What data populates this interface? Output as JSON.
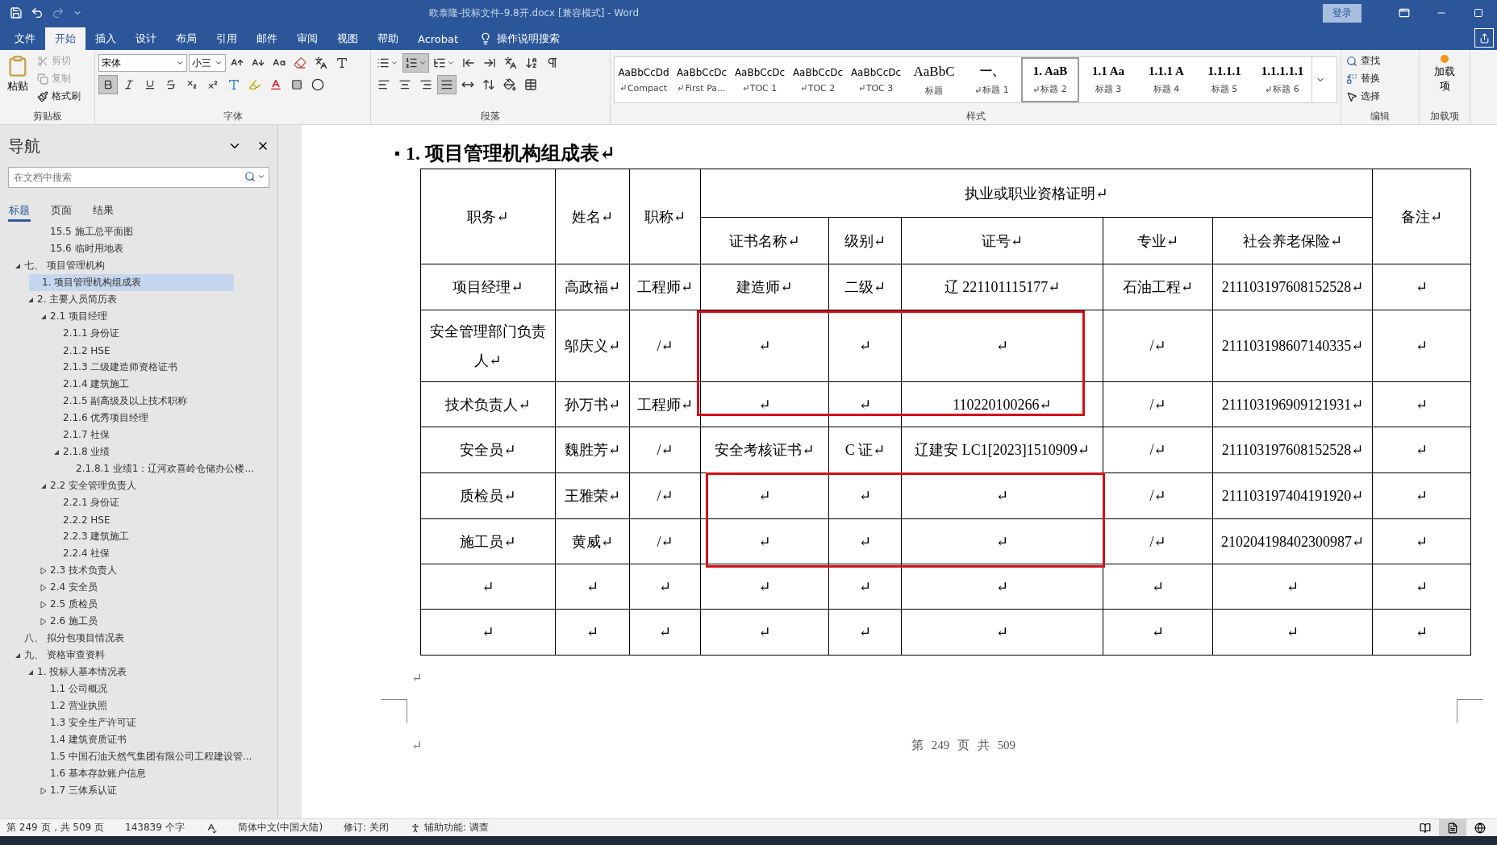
{
  "window": {
    "title": "欧泰隆-投标文件-9.8开.docx [兼容模式]  -  Word",
    "sign_in": "登录"
  },
  "ribbon_tabs": [
    {
      "label": "文件",
      "selected": false
    },
    {
      "label": "开始",
      "selected": true
    },
    {
      "label": "插入",
      "selected": false
    },
    {
      "label": "设计",
      "selected": false
    },
    {
      "label": "布局",
      "selected": false
    },
    {
      "label": "引用",
      "selected": false
    },
    {
      "label": "邮件",
      "selected": false
    },
    {
      "label": "审阅",
      "selected": false
    },
    {
      "label": "视图",
      "selected": false
    },
    {
      "label": "帮助",
      "selected": false
    },
    {
      "label": "Acrobat",
      "selected": false
    }
  ],
  "tell_me": "操作说明搜索",
  "clipboard": {
    "label": "剪贴板",
    "paste": "粘贴",
    "cut": {
      "label": "剪切",
      "disabled": true
    },
    "copy": {
      "label": "复制",
      "disabled": true
    },
    "format_painter": {
      "label": "格式刷",
      "disabled": false
    }
  },
  "font": {
    "label": "字体",
    "name": "宋体",
    "size": "小三",
    "format_buttons": [
      {
        "active": true
      },
      {
        "active": false
      },
      {
        "active": false
      },
      {
        "active": false
      },
      {
        "active": false
      },
      {
        "active": false
      }
    ]
  },
  "paragraph": {
    "label": "段落",
    "list_buttons": [
      {
        "active": false
      },
      {
        "active": true
      },
      {
        "active": false
      }
    ],
    "align_buttons": [
      {
        "active": false
      },
      {
        "active": false
      },
      {
        "active": false
      },
      {
        "active": true
      },
      {
        "active": false
      }
    ]
  },
  "styles": {
    "label": "样式",
    "items": [
      {
        "preview": "AaBbCcDd",
        "name": "Compact",
        "kind": "body",
        "paragraph_mark": true,
        "selected": false
      },
      {
        "preview": "AaBbCcDc",
        "name": "First Pa...",
        "kind": "body",
        "paragraph_mark": true,
        "selected": false
      },
      {
        "preview": "AaBbCcDc",
        "name": "TOC 1",
        "kind": "body",
        "paragraph_mark": true,
        "selected": false
      },
      {
        "preview": "AaBbCcDc",
        "name": "TOC 2",
        "kind": "body",
        "paragraph_mark": true,
        "selected": false
      },
      {
        "preview": "AaBbCcDc",
        "name": "TOC 3",
        "kind": "body",
        "paragraph_mark": true,
        "selected": false
      },
      {
        "preview": "AaBbC",
        "name": "标题",
        "kind": "title",
        "paragraph_mark": false,
        "selected": false
      },
      {
        "preview": "一、",
        "name": "标题 1",
        "kind": "heading",
        "paragraph_mark": true,
        "selected": false
      },
      {
        "preview": "1. AaB",
        "name": "标题 2",
        "kind": "heading",
        "paragraph_mark": true,
        "selected": true
      },
      {
        "preview": "1.1 Aa",
        "name": "标题 3",
        "kind": "heading",
        "paragraph_mark": false,
        "selected": false
      },
      {
        "preview": "1.1.1 A",
        "name": "标题 4",
        "kind": "heading",
        "paragraph_mark": false,
        "selected": false
      },
      {
        "preview": "1.1.1.1",
        "name": "标题 5",
        "kind": "heading",
        "paragraph_mark": false,
        "selected": false
      },
      {
        "preview": "1.1.1.1.1",
        "name": "标题 6",
        "kind": "heading",
        "paragraph_mark": true,
        "selected": false
      }
    ]
  },
  "editing": {
    "label": "编辑",
    "find": "查找",
    "replace": "替换",
    "select": "选择"
  },
  "addins": {
    "label": "加载项",
    "button": "加载项"
  },
  "navigation": {
    "title": "导航",
    "search": {
      "placeholder": "在文档中搜索"
    },
    "tabs": [
      {
        "label": "标题",
        "selected": true
      },
      {
        "label": "页面",
        "selected": false
      },
      {
        "label": "结果",
        "selected": false
      }
    ],
    "scrolled_items": [
      "15.5 施工总平面图",
      "15.6 临时用地表"
    ],
    "tree": [
      {
        "label": "七、 项目管理机构",
        "expanded": true,
        "selected": false,
        "children": [
          {
            "label": "1. 项目管理机构组成表",
            "selected": true
          },
          {
            "label": "2. 主要人员简历表",
            "expanded": true,
            "selected": false,
            "children": [
              {
                "label": "2.1 项目经理",
                "expanded": true,
                "selected": false,
                "children": [
                  {
                    "label": "2.1.1 身份证",
                    "selected": false
                  },
                  {
                    "label": "2.1.2 HSE",
                    "selected": false
                  },
                  {
                    "label": "2.1.3 二级建造师资格证书",
                    "selected": false
                  },
                  {
                    "label": "2.1.4 建筑施工",
                    "selected": false
                  },
                  {
                    "label": "2.1.5 副高级及以上技术职称",
                    "selected": false
                  },
                  {
                    "label": "2.1.6 优秀项目经理",
                    "selected": false
                  },
                  {
                    "label": "2.1.7 社保",
                    "selected": false
                  },
                  {
                    "label": "2.1.8 业绩",
                    "expanded": true,
                    "selected": false,
                    "children": [
                      {
                        "label": "2.1.8.1 业绩1：辽河欢喜岭仓储办公楼...",
                        "selected": false
                      }
                    ]
                  }
                ]
              },
              {
                "label": "2.2 安全管理负责人",
                "expanded": true,
                "selected": false,
                "children": [
                  {
                    "label": "2.2.1 身份证",
                    "selected": false
                  },
                  {
                    "label": "2.2.2 HSE",
                    "selected": false
                  },
                  {
                    "label": "2.2.3 建筑施工",
                    "selected": false
                  },
                  {
                    "label": "2.2.4 社保",
                    "selected": false
                  }
                ]
              },
              {
                "label": "2.3 技术负责人",
                "expanded": false,
                "selected": false
              },
              {
                "label": "2.4 安全员",
                "expanded": false,
                "selected": false
              },
              {
                "label": "2.5 质检员",
                "expanded": false,
                "selected": false
              },
              {
                "label": "2.6 施工员",
                "expanded": false,
                "selected": false
              }
            ]
          }
        ]
      },
      {
        "label": "八、 拟分包项目情况表",
        "selected": false
      },
      {
        "label": "九、 资格审查资料",
        "expanded": true,
        "selected": false,
        "children": [
          {
            "label": "1. 投标人基本情况表",
            "expanded": true,
            "selected": false,
            "children": [
              {
                "label": "1.1 公司概况",
                "selected": false
              },
              {
                "label": "1.2 营业执照",
                "selected": false
              },
              {
                "label": "1.3 安全生产许可证",
                "selected": false
              },
              {
                "label": "1.4 建筑资质证书",
                "selected": false
              },
              {
                "label": "1.5 中国石油天然气集团有限公司工程建设管...",
                "selected": false
              },
              {
                "label": "1.6 基本存款账户信息",
                "selected": false
              },
              {
                "label": "1.7 三体系认证",
                "expanded": false,
                "selected": false
              }
            ]
          }
        ]
      }
    ]
  },
  "document": {
    "heading": "1.  项目管理机构组成表↵",
    "table": {
      "header_top": [
        "职务↵",
        "姓名↵",
        "职称↵",
        "执业或职业资格证明↵",
        "备注↵"
      ],
      "header_sub": [
        "证书名称↵",
        "级别↵",
        "证号↵",
        "专业↵",
        "社会养老保险↵"
      ],
      "rows": [
        [
          "项目经理↵",
          "高政福↵",
          "工程师↵",
          "建造师↵",
          "二级↵",
          "辽 221101115177↵",
          "石油工程↵",
          "211103197608152528↵",
          "↵"
        ],
        [
          "安全管理部门负责人↵",
          "邬庆义↵",
          "/↵",
          "↵",
          "↵",
          "↵",
          "/↵",
          "211103198607140335↵",
          "↵"
        ],
        [
          "技术负责人↵",
          "孙万书↵",
          "工程师↵",
          "↵",
          "↵",
          "110220100266↵",
          "/↵",
          "211103196909121931↵",
          "↵"
        ],
        [
          "安全员↵",
          "魏胜芳↵",
          "/↵",
          "安全考核证书↵",
          "C 证↵",
          "辽建安 LC1[2023]1510909↵",
          "/↵",
          "211103197608152528↵",
          "↵"
        ],
        [
          "质检员↵",
          "王雅荣↵",
          "/↵",
          "↵",
          "↵",
          "↵",
          "/↵",
          "211103197404191920↵",
          "↵"
        ],
        [
          "施工员↵",
          "黄威↵",
          "/↵",
          "↵",
          "↵",
          "↵",
          "/↵",
          "210204198402300987↵",
          "↵"
        ],
        [
          "↵",
          "↵",
          "↵",
          "↵",
          "↵",
          "↵",
          "↵",
          "↵",
          "↵"
        ],
        [
          "↵",
          "↵",
          "↵",
          "↵",
          "↵",
          "↵",
          "↵",
          "↵",
          "↵"
        ]
      ]
    },
    "after_table_mark": "↵",
    "footer_mark": "↵",
    "footer": "第 249 页 共 509"
  },
  "status_bar": {
    "page": "第 249 页，共 509 页",
    "words": "143839 个字",
    "language": "简体中文(中国大陆)",
    "track_changes": "修订: 关闭",
    "accessibility": "辅助功能: 调查",
    "view_buttons": [
      {
        "selected": false
      },
      {
        "selected": true
      },
      {
        "selected": false
      }
    ]
  }
}
